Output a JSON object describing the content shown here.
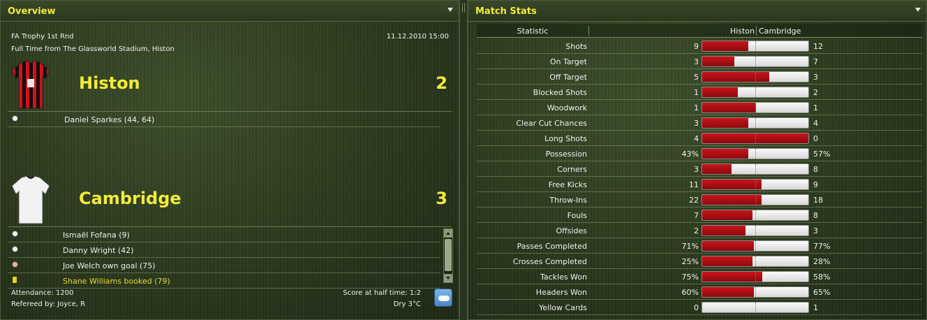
{
  "overview": {
    "title": "Overview",
    "competition": "FA Trophy 1st Rnd",
    "datetime": "11.12.2010 15:00",
    "venue_line": "Full Time from The Glassworld Stadium, Histon",
    "home": {
      "name": "Histon",
      "score": "2",
      "events": [
        {
          "icon": "goal",
          "text": "Daniel Sparkes (44, 64)"
        }
      ]
    },
    "away": {
      "name": "Cambridge",
      "score": "3",
      "events": [
        {
          "icon": "goal",
          "text": "Ismaël Fofana (9)"
        },
        {
          "icon": "goal",
          "text": "Danny Wright (42)"
        },
        {
          "icon": "own-goal",
          "text": "Joe Welch own goal (75)"
        },
        {
          "icon": "yellow-card",
          "text": "Shane Williams booked (79)"
        }
      ]
    },
    "attendance": "Attendance: 1200",
    "referee": "Refereed by: Joyce, R",
    "half_time": "Score at half time: 1:2",
    "weather": "Dry 3°C"
  },
  "stats": {
    "title": "Match Stats",
    "col_stat": "Statistic",
    "col_home": "Histon",
    "col_away": "Cambridge",
    "colors": {
      "home_bar": "#b8101a",
      "away_bar": "#eeeeee"
    },
    "rows": [
      {
        "label": "Shots",
        "home": "9",
        "away": "12",
        "home_share": 0.43
      },
      {
        "label": "On Target",
        "home": "3",
        "away": "7",
        "home_share": 0.3
      },
      {
        "label": "Off Target",
        "home": "5",
        "away": "3",
        "home_share": 0.625
      },
      {
        "label": "Blocked Shots",
        "home": "1",
        "away": "2",
        "home_share": 0.33
      },
      {
        "label": "Woodwork",
        "home": "1",
        "away": "1",
        "home_share": 0.5
      },
      {
        "label": "Clear Cut Chances",
        "home": "3",
        "away": "4",
        "home_share": 0.43
      },
      {
        "label": "Long Shots",
        "home": "4",
        "away": "0",
        "home_share": 1.0
      },
      {
        "label": "Possession",
        "home": "43%",
        "away": "57%",
        "home_share": 0.43
      },
      {
        "label": "Corners",
        "home": "3",
        "away": "8",
        "home_share": 0.27
      },
      {
        "label": "Free Kicks",
        "home": "11",
        "away": "9",
        "home_share": 0.55
      },
      {
        "label": "Throw-Ins",
        "home": "22",
        "away": "18",
        "home_share": 0.55
      },
      {
        "label": "Fouls",
        "home": "7",
        "away": "8",
        "home_share": 0.47
      },
      {
        "label": "Offsides",
        "home": "2",
        "away": "3",
        "home_share": 0.4
      },
      {
        "label": "Passes Completed",
        "home": "71%",
        "away": "77%",
        "home_share": 0.48
      },
      {
        "label": "Crosses Completed",
        "home": "25%",
        "away": "28%",
        "home_share": 0.47
      },
      {
        "label": "Tackles Won",
        "home": "75%",
        "away": "58%",
        "home_share": 0.56
      },
      {
        "label": "Headers Won",
        "home": "60%",
        "away": "65%",
        "home_share": 0.48
      },
      {
        "label": "Yellow Cards",
        "home": "0",
        "away": "1",
        "home_share": 0.0
      }
    ]
  }
}
